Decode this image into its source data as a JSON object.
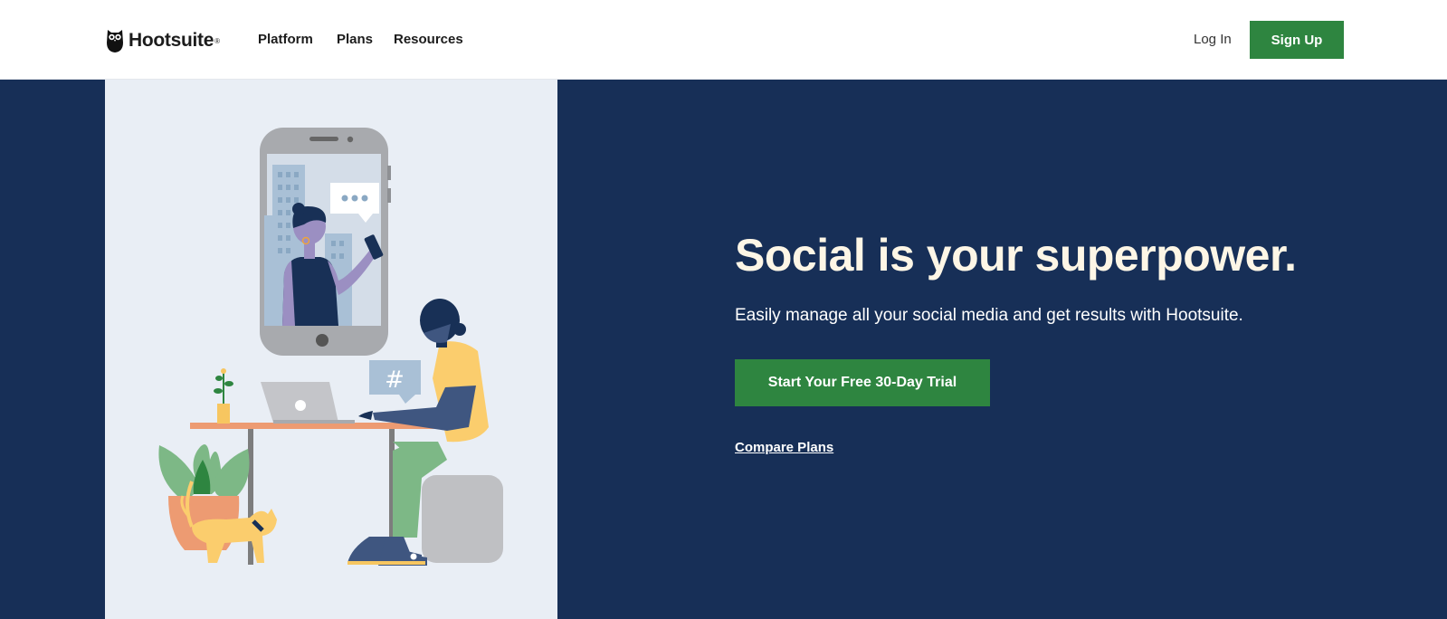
{
  "nav": {
    "brand": "Hootsuite",
    "brand_mark": "®",
    "links": [
      "Platform",
      "Plans",
      "Resources"
    ],
    "login_label": "Log In",
    "signup_label": "Sign Up"
  },
  "hero": {
    "title": "Social is your superpower.",
    "subtitle": "Easily manage all your social media and get results with Hootsuite.",
    "cta_label": "Start Your Free 30-Day Trial",
    "compare_label": "Compare Plans",
    "hashtag": "#"
  },
  "colors": {
    "hero_bg": "#172f57",
    "brand_green": "#2e8540",
    "headline": "#fdf6e6",
    "illustration_bg": "#e9eef5"
  }
}
